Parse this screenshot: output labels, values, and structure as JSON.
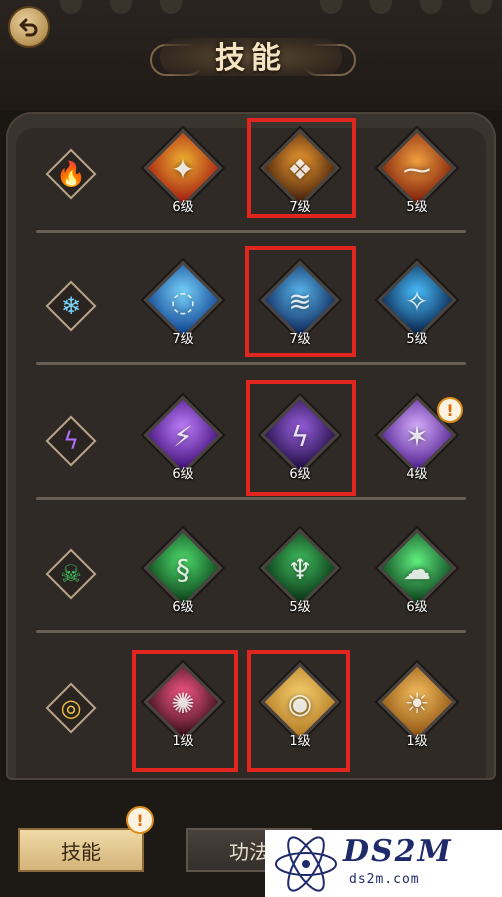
{
  "header": {
    "title": "技能",
    "back_icon": "back-arrow-icon"
  },
  "rows": [
    {
      "element": "fire",
      "element_icon": "fire-icon",
      "skills": [
        {
          "level": "6级",
          "colors": [
            "#f0b030",
            "#a01810"
          ],
          "glyph": "✦"
        },
        {
          "level": "7级",
          "colors": [
            "#f09a30",
            "#3a1a0a"
          ],
          "glyph": "❖"
        },
        {
          "level": "5级",
          "colors": [
            "#f0a040",
            "#7a1a08"
          ],
          "glyph": "⁓"
        }
      ]
    },
    {
      "element": "ice",
      "element_icon": "snowflake-icon",
      "skills": [
        {
          "level": "7级",
          "colors": [
            "#7ad6ff",
            "#0a3a8a"
          ],
          "glyph": "◌"
        },
        {
          "level": "7级",
          "colors": [
            "#5ab8f0",
            "#0a2050"
          ],
          "glyph": "≋"
        },
        {
          "level": "5级",
          "colors": [
            "#4ac0ff",
            "#061a40"
          ],
          "glyph": "✧"
        }
      ]
    },
    {
      "element": "lightning",
      "element_icon": "lightning-icon",
      "skills": [
        {
          "level": "6级",
          "colors": [
            "#c080ff",
            "#3a0a70"
          ],
          "glyph": "⚡"
        },
        {
          "level": "6级",
          "colors": [
            "#9a60e0",
            "#1a0a3a"
          ],
          "glyph": "ϟ"
        },
        {
          "level": "4级",
          "colors": [
            "#d8b0ff",
            "#4a1a8a"
          ],
          "glyph": "✶"
        }
      ]
    },
    {
      "element": "poison",
      "element_icon": "skull-icon",
      "skills": [
        {
          "level": "6级",
          "colors": [
            "#50e070",
            "#0a3a14"
          ],
          "glyph": "§"
        },
        {
          "level": "5级",
          "colors": [
            "#40c060",
            "#082a10"
          ],
          "glyph": "♆"
        },
        {
          "level": "6级",
          "colors": [
            "#60f080",
            "#0a3a18"
          ],
          "glyph": "☁"
        }
      ]
    },
    {
      "element": "light",
      "element_icon": "eye-icon",
      "skills": [
        {
          "level": "1级",
          "colors": [
            "#ff5a8a",
            "#2a0a14"
          ],
          "glyph": "✺"
        },
        {
          "level": "1级",
          "colors": [
            "#f8d070",
            "#b07820"
          ],
          "glyph": "◉"
        },
        {
          "level": "1级",
          "colors": [
            "#f8c060",
            "#8a5010"
          ],
          "glyph": "☀"
        }
      ]
    }
  ],
  "alert_mark": "!",
  "tabs": [
    {
      "label": "技能",
      "active": true
    },
    {
      "label": "功法",
      "active": false
    }
  ],
  "watermark": {
    "main": "DS2M",
    "sub": "ds2m.com"
  },
  "colors": {
    "highlight": "#e0261f",
    "accent": "#d4b47a"
  }
}
